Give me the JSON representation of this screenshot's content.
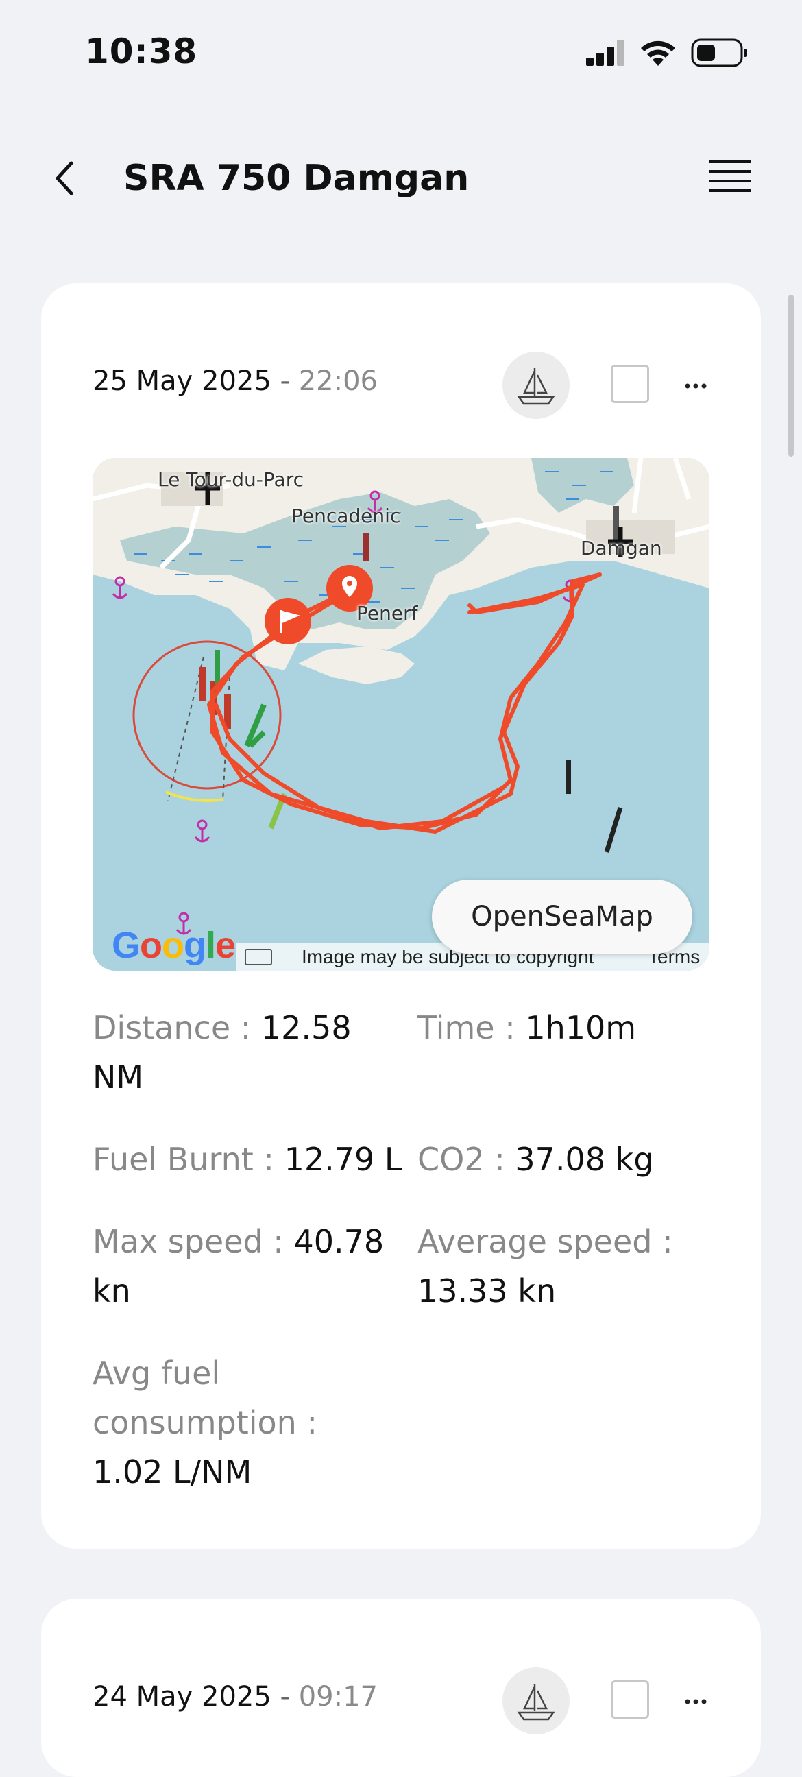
{
  "status_bar": {
    "time": "10:38"
  },
  "header": {
    "title": "SRA 750 Damgan"
  },
  "trips": [
    {
      "date": "25 May 2025",
      "separator": " - ",
      "time": "22:06",
      "map": {
        "places": [
          "Le Tour-du-Parc",
          "Pencadenic",
          "Penerf",
          "Damgan"
        ],
        "layer_button": "OpenSeaMap",
        "attribution": "Image may be subject to copyright",
        "terms": "Terms",
        "logo": "Google"
      },
      "stats": [
        {
          "label": "Distance : ",
          "value": "12.58 NM"
        },
        {
          "label": "Time : ",
          "value": "1h10m"
        },
        {
          "label": "Fuel Burnt : ",
          "value": "12.79 L"
        },
        {
          "label": "CO2 : ",
          "value": "37.08 kg"
        },
        {
          "label": "Max speed : ",
          "value": "40.78 kn"
        },
        {
          "label": "Average speed : ",
          "value": "13.33 kn"
        },
        {
          "label": "Avg fuel consumption : ",
          "value": "1.02 L/NM"
        }
      ]
    },
    {
      "date": "24 May 2025",
      "separator": " - ",
      "time": "09:17"
    }
  ],
  "colors": {
    "track": "#ef4b2a",
    "sea": "#aad3df",
    "land": "#f2efe9",
    "page_bg": "#f1f2f5"
  }
}
